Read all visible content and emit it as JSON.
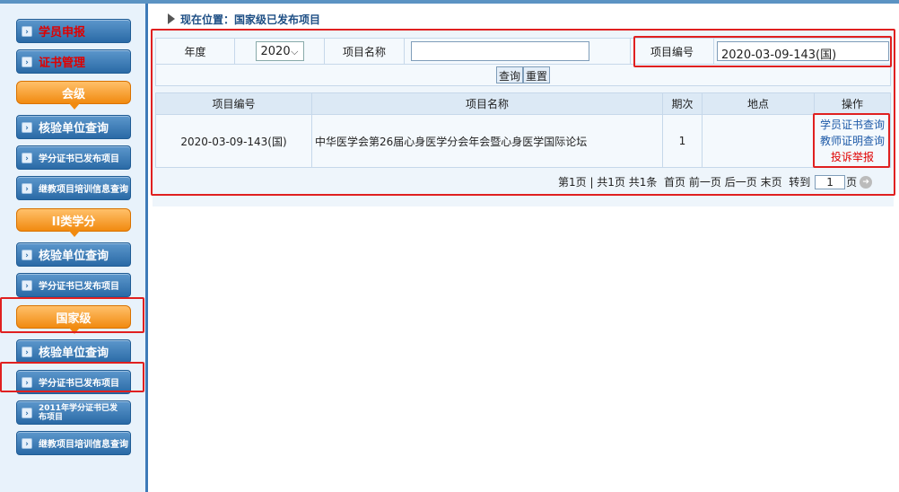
{
  "sidebar": {
    "items": [
      {
        "label": "学员申报"
      },
      {
        "label": "证书管理"
      },
      {
        "label": "会级"
      },
      {
        "label": "核验单位查询"
      },
      {
        "label": "学分证书已发布项目"
      },
      {
        "label": "继教项目培训信息查询"
      },
      {
        "label": "II类学分"
      },
      {
        "label": "核验单位查询"
      },
      {
        "label": "学分证书已发布项目"
      },
      {
        "label": "国家级"
      },
      {
        "label": "核验单位查询"
      },
      {
        "label": "学分证书已发布项目"
      },
      {
        "label": "2011年学分证书已发布项目"
      },
      {
        "label": "继教项目培训信息查询"
      }
    ]
  },
  "breadcrumb": "现在位置：国家级已发布项目",
  "filter": {
    "year_label": "年度",
    "year_value": "2020",
    "name_label": "项目名称",
    "name_value": "",
    "code_label": "项目编号",
    "code_value": "2020-03-09-143(国)",
    "query_button": "查询",
    "reset_button": "重置"
  },
  "table": {
    "headers": [
      "项目编号",
      "项目名称",
      "期次",
      "地点",
      "操作"
    ],
    "rows": [
      {
        "code": "2020-03-09-143(国)",
        "name": "中华医学会第26届心身医学分会年会暨心身医学国际论坛",
        "session": "1",
        "location": "",
        "actions": [
          "学员证书查询",
          "教师证明查询",
          "投诉举报"
        ]
      }
    ]
  },
  "pager": {
    "info": "第1页 | 共1页 共1条",
    "first": "首页",
    "prev": "前一页",
    "next": "后一页",
    "last": "末页",
    "goto_label": "转到",
    "page_value": "1",
    "page_suffix": "页"
  }
}
